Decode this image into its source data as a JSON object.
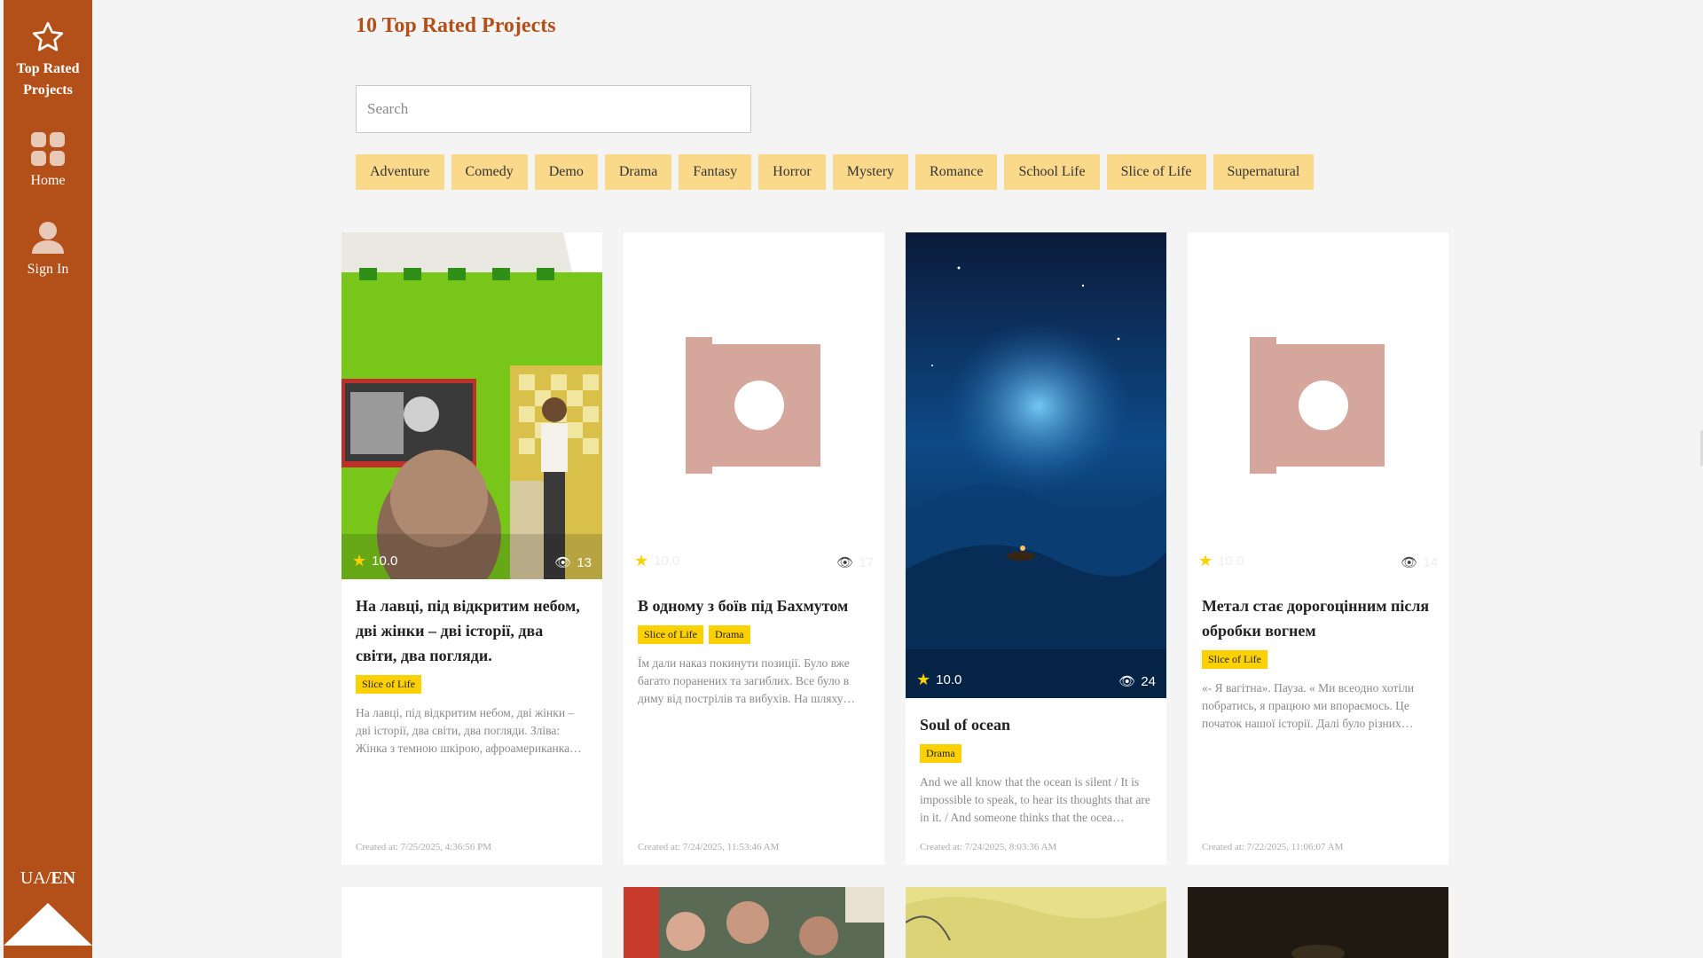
{
  "sidebar": {
    "top_rated_label": "Top Rated Projects",
    "home_label": "Home",
    "signin_label": "Sign In",
    "lang_ua": "UA",
    "lang_sep": "/",
    "lang_en": "EN"
  },
  "page": {
    "title": "10 Top Rated Projects"
  },
  "search": {
    "placeholder": "Search"
  },
  "genres": [
    "Adventure",
    "Comedy",
    "Demo",
    "Drama",
    "Fantasy",
    "Horror",
    "Mystery",
    "Romance",
    "School Life",
    "Slice of Life",
    "Supernatural"
  ],
  "cards": [
    {
      "rating": "10.0",
      "views": "13",
      "title": "На лавці, під відкритим небом, дві жінки – дві історії, два світи, два погляди.",
      "tags": [
        "Slice of Life"
      ],
      "description": "На лавці, під відкритим небом, дві жінки – дві історії, два світи, два погляди. Зліва: Жінка з темною шкірою, афроамериканка…",
      "created": "Created at: 7/25/2025, 4:36:56 PM"
    },
    {
      "rating": "10.0",
      "views": "17",
      "title": "В одному з боїв під Бахмутом",
      "tags": [
        "Slice of Life",
        "Drama"
      ],
      "description": "Їм дали наказ покинути позиції. Було вже багато поранених та загиблих. Все було в диму від пострілів та вибухів. На шляху…",
      "created": "Created at: 7/24/2025, 11:53:46 AM"
    },
    {
      "rating": "10.0",
      "views": "24",
      "title": "Soul of ocean",
      "tags": [
        "Drama"
      ],
      "description": "And we all know that the ocean is silent / It is impossible to speak, to hear its thoughts that are in it. / And someone thinks that the ocea…",
      "created": "Created at: 7/24/2025, 8:03:36 AM"
    },
    {
      "rating": "10.0",
      "views": "14",
      "title": "Метал стає дорогоцінним після обробки вогнем",
      "tags": [
        "Slice of Life"
      ],
      "description": "«- Я вагітна». Пауза. « Ми всеодно хотіли побратись, я працюю ми впораємось. Це початок нашої історії. Далі було різних…",
      "created": "Created at: 7/22/2025, 11:06:07 AM"
    }
  ]
}
